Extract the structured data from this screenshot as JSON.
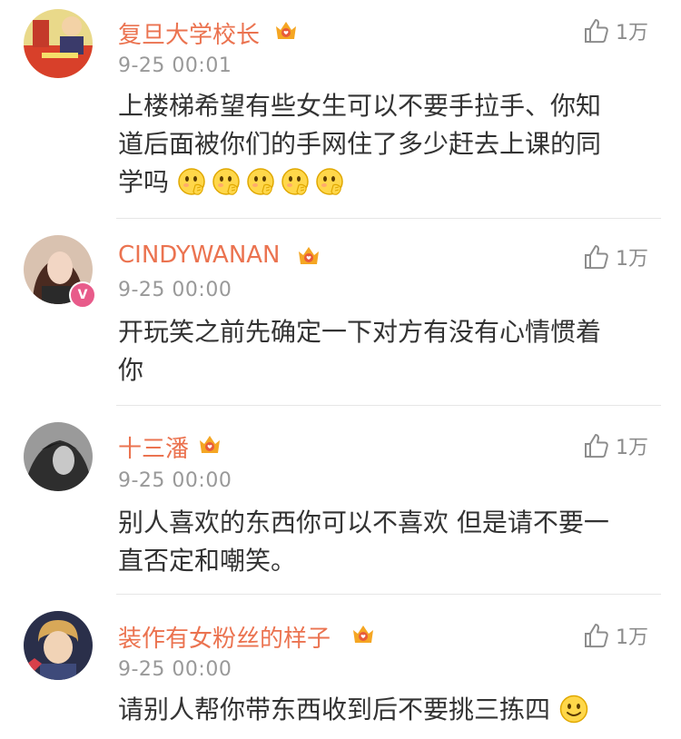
{
  "comments": [
    {
      "name": "复旦大学校长",
      "time": "9-25 00:01",
      "likes": "1万",
      "text_lines": [
        "上楼梯希望有些女生可以不要手拉手、你知",
        "道后面被你们的手网住了多少赶去上课的同",
        "学吗"
      ],
      "emoji": "shy-face-icon",
      "emoji_count": 5
    },
    {
      "name": "CINDYWANAN",
      "time": "9-25 00:00",
      "likes": "1万",
      "text_lines": [
        "开玩笑之前先确定一下对方有没有心情惯着",
        "你"
      ]
    },
    {
      "name": "十三潘",
      "time": "9-25 00:00",
      "likes": "1万",
      "text_lines": [
        "别人喜欢的东西你可以不喜欢 但是请不要一",
        "直否定和嘲笑。"
      ]
    },
    {
      "name": "装作有女粉丝的样子",
      "time": "9-25 00:00",
      "likes": "1万",
      "text_lines": [
        "请别人帮你带东西收到后不要挑三拣四"
      ],
      "emoji": "smile-face-icon",
      "emoji_count": 1
    }
  ],
  "colors": {
    "name": "#eb7350",
    "time": "#999999",
    "text": "#333333",
    "like": "#8c8c8c",
    "badge": "#f5a623"
  },
  "icons": [
    "thumbs-up-icon",
    "crown-badge-icon",
    "v-verified-icon"
  ]
}
